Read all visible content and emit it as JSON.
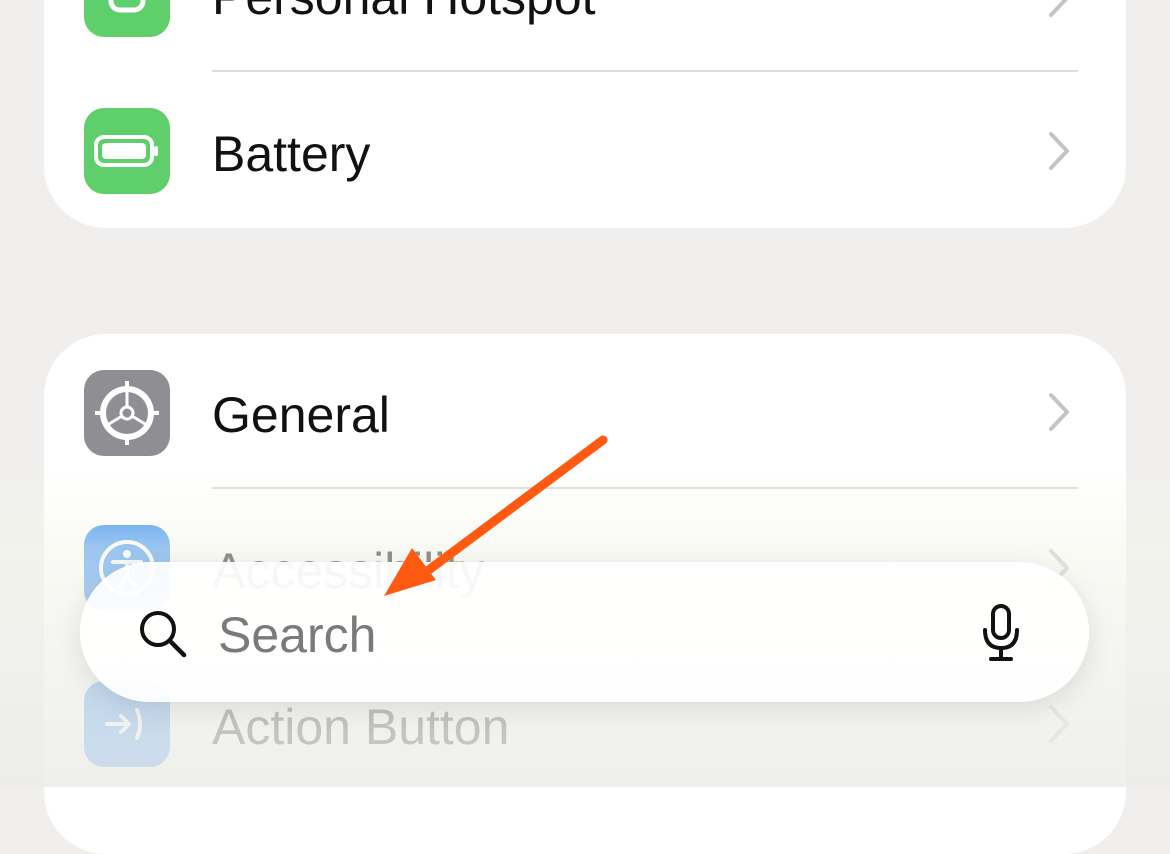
{
  "settings_group_1": {
    "items": [
      {
        "label": "Personal Hotspot",
        "icon": "personal-hotspot-icon",
        "icon_color": "#5fcf6b"
      },
      {
        "label": "Battery",
        "icon": "battery-icon",
        "icon_color": "#5fcf6b"
      }
    ]
  },
  "settings_group_2": {
    "items": [
      {
        "label": "General",
        "icon": "gear-icon",
        "icon_color": "#8e8e93"
      },
      {
        "label": "Accessibility",
        "icon": "accessibility-icon",
        "icon_color": "#2f8cf5"
      },
      {
        "label": "Action Button",
        "icon": "action-button-icon",
        "icon_color": "#2f8cf5"
      }
    ]
  },
  "search": {
    "placeholder": "Search",
    "mic_icon": "microphone-icon"
  },
  "annotation": {
    "arrow_color": "#ff5a12"
  }
}
